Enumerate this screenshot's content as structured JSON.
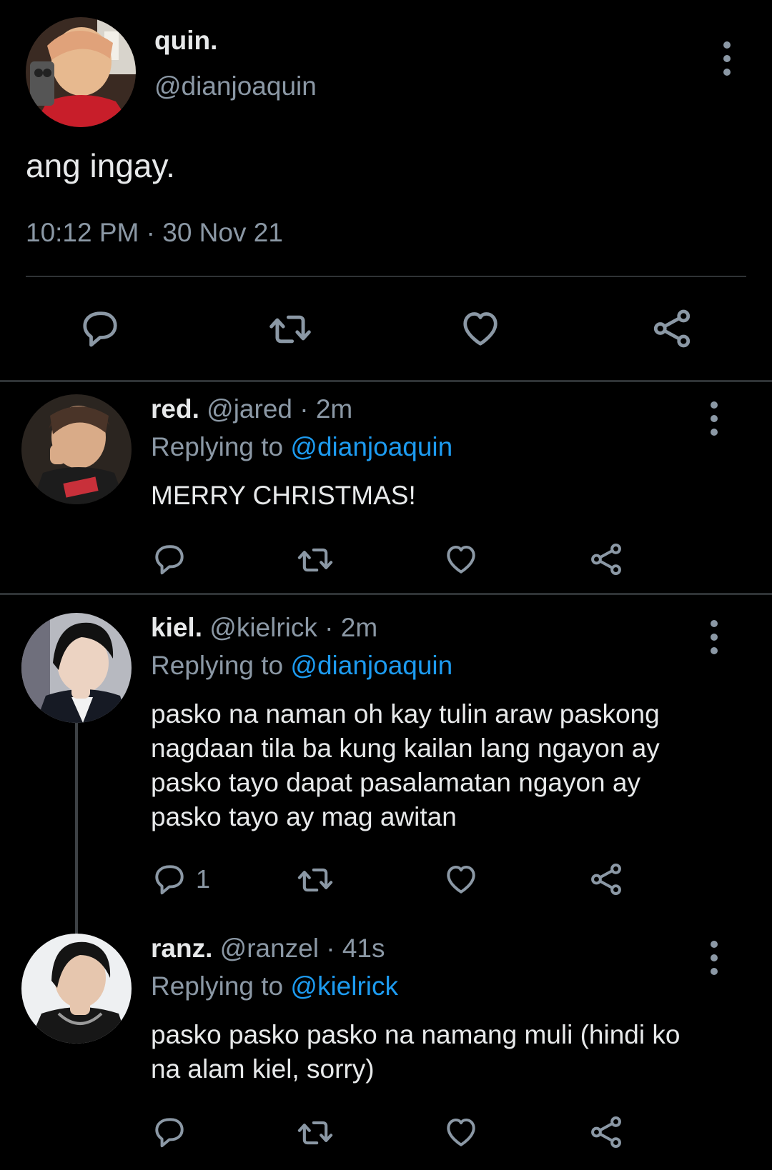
{
  "main_tweet": {
    "display_name": "quin.",
    "handle": "@dianjoaquin",
    "text": "ang ingay.",
    "timestamp": "10:12 PM · 30 Nov 21",
    "actions": [
      "reply-icon",
      "retweet-icon",
      "like-icon",
      "share-icon"
    ]
  },
  "replies": [
    {
      "display_name": "red.",
      "meta": "@jared · 2m",
      "replying_prefix": "Replying to ",
      "replying_to": "@dianjoaquin",
      "text": "MERRY CHRISTMAS!",
      "reply_count": ""
    },
    {
      "display_name": "kiel.",
      "meta": "@kielrick · 2m",
      "replying_prefix": "Replying to ",
      "replying_to": "@dianjoaquin",
      "text": "pasko na naman oh kay tulin araw paskong nagdaan tila ba kung kailan lang ngayon ay pasko tayo dapat pasalamatan ngayon ay pasko tayo ay mag awitan",
      "reply_count": "1"
    },
    {
      "display_name": "ranz.",
      "meta": "@ranzel · 41s",
      "replying_prefix": "Replying to ",
      "replying_to": "@kielrick",
      "text": "pasko pasko pasko na namang muli (hindi ko na alam kiel, sorry)",
      "reply_count": ""
    }
  ],
  "colors": {
    "background": "#000000",
    "text": "#e7e9ea",
    "muted": "#8b98a5",
    "link": "#1d9bf0",
    "divider": "#2f3336"
  }
}
